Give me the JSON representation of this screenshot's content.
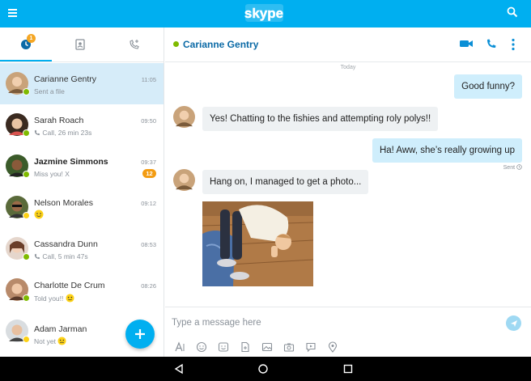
{
  "topbar": {
    "logo_text": "skype"
  },
  "tabs": {
    "recent_badge": "1"
  },
  "conversations": [
    {
      "name": "Carianne Gentry",
      "sub": "Sent a file",
      "time": "11:05",
      "bold": false,
      "unread": "",
      "status": "online"
    },
    {
      "name": "Sarah Roach",
      "sub": "Call, 26 min 23s",
      "time": "09:50",
      "bold": false,
      "unread": "",
      "status": "online",
      "call": true
    },
    {
      "name": "Jazmine Simmons",
      "sub": "Miss you! X",
      "time": "09:37",
      "bold": true,
      "unread": "12",
      "status": "online"
    },
    {
      "name": "Nelson Morales",
      "sub": "",
      "time": "09:12",
      "bold": false,
      "unread": "",
      "status": "away",
      "emoji": true
    },
    {
      "name": "Cassandra Dunn",
      "sub": "Call, 5 min 47s",
      "time": "08:53",
      "bold": false,
      "unread": "",
      "status": "online",
      "call": true
    },
    {
      "name": "Charlotte De Crum",
      "sub": "Told you!!",
      "time": "08:26",
      "bold": false,
      "unread": "",
      "status": "online",
      "emoji": true
    },
    {
      "name": "Adam Jarman",
      "sub": "Not yet",
      "time": "",
      "bold": false,
      "unread": "",
      "status": "away",
      "emoji": true
    }
  ],
  "chat": {
    "title": "Carianne Gentry",
    "date_divider": "Today",
    "messages": [
      {
        "dir": "out",
        "text": "Good funny?"
      },
      {
        "dir": "in",
        "text": "Yes! Chatting to the fishies and attempting roly polys!!"
      },
      {
        "dir": "out",
        "text": "Ha! Aww, she’s really growing up"
      },
      {
        "dir": "in",
        "text": "Hang on, I managed to get a photo..."
      }
    ],
    "sent_label": "Sent"
  },
  "composer": {
    "placeholder": "Type a message here"
  },
  "colors": {
    "accent": "#00aff0",
    "header_title": "#0b6aa6",
    "online": "#7fba00",
    "away": "#fcd116",
    "unread": "#f39c12"
  }
}
